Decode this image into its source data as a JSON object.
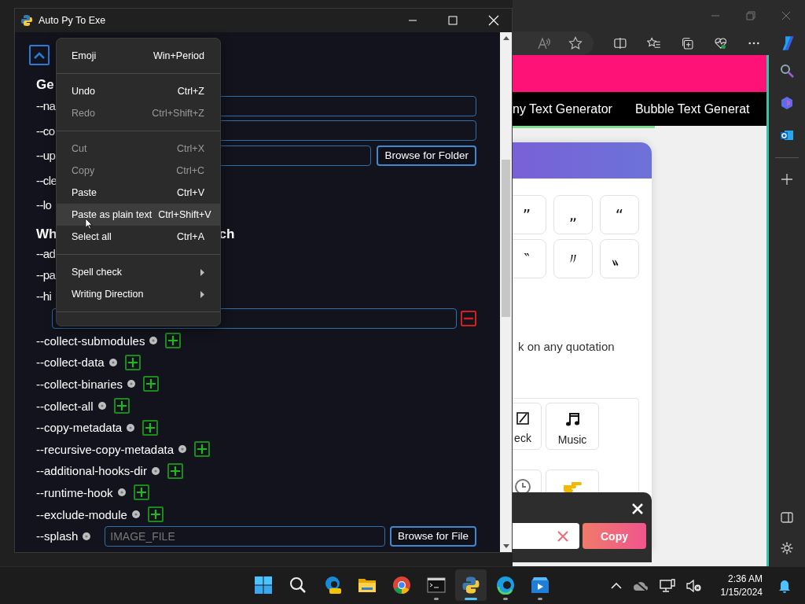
{
  "app_window": {
    "title": "Auto Py To Exe",
    "general": {
      "heading": "Ge",
      "rows": [
        {
          "kind": "input",
          "label": "--na"
        },
        {
          "kind": "input",
          "label": "--co"
        },
        {
          "kind": "folder",
          "label": "--up",
          "button": "Browse for Folder"
        },
        {
          "kind": "plain",
          "label": "--cle"
        },
        {
          "kind": "plain",
          "label": "--lo"
        }
      ]
    },
    "bundle": {
      "heading_start": "Wh",
      "heading_end": "ch",
      "rows": [
        {
          "kind": "plain",
          "label": "--ad"
        },
        {
          "kind": "plain",
          "label": "--pa"
        },
        {
          "kind": "plain",
          "label": "--hi"
        },
        {
          "kind": "entry"
        },
        {
          "kind": "add",
          "label": "--collect-submodules"
        },
        {
          "kind": "add",
          "label": "--collect-data"
        },
        {
          "kind": "add",
          "label": "--collect-binaries"
        },
        {
          "kind": "add",
          "label": "--collect-all"
        },
        {
          "kind": "add",
          "label": "--copy-metadata"
        },
        {
          "kind": "add",
          "label": "--recursive-copy-metadata"
        },
        {
          "kind": "add",
          "label": "--additional-hooks-dir"
        },
        {
          "kind": "add",
          "label": "--runtime-hook"
        },
        {
          "kind": "add",
          "label": "--exclude-module"
        },
        {
          "kind": "file",
          "label": "--splash",
          "placeholder": "IMAGE_FILE",
          "button": "Browse for File"
        }
      ]
    }
  },
  "context_menu": {
    "items": [
      {
        "kind": "item",
        "label": "Emoji",
        "shortcut": "Win+Period",
        "disabled": false,
        "selected": false
      },
      {
        "kind": "separator"
      },
      {
        "kind": "item",
        "label": "Undo",
        "shortcut": "Ctrl+Z",
        "disabled": false,
        "selected": false
      },
      {
        "kind": "item",
        "label": "Redo",
        "shortcut": "Ctrl+Shift+Z",
        "disabled": true,
        "selected": false
      },
      {
        "kind": "separator"
      },
      {
        "kind": "item",
        "label": "Cut",
        "shortcut": "Ctrl+X",
        "disabled": true,
        "selected": false
      },
      {
        "kind": "item",
        "label": "Copy",
        "shortcut": "Ctrl+C",
        "disabled": true,
        "selected": false
      },
      {
        "kind": "item",
        "label": "Paste",
        "shortcut": "Ctrl+V",
        "disabled": false,
        "selected": false
      },
      {
        "kind": "item",
        "label": "Paste as plain text",
        "shortcut": "Ctrl+Shift+V",
        "disabled": false,
        "selected": true
      },
      {
        "kind": "item",
        "label": "Select all",
        "shortcut": "Ctrl+A",
        "disabled": false,
        "selected": false
      },
      {
        "kind": "separator"
      },
      {
        "kind": "submenu",
        "label": "Spell check",
        "disabled": false,
        "selected": false
      },
      {
        "kind": "submenu",
        "label": "Writing Direction",
        "disabled": false,
        "selected": false
      },
      {
        "kind": "separator"
      }
    ]
  },
  "browser": {
    "nav_links": [
      "ny Text Generator",
      "Bubble Text Generat"
    ],
    "quote_buttons": [
      "”",
      "„",
      "“",
      "‶",
      "〃",
      "〟"
    ],
    "instruction": "k on any quotation",
    "reading_progress": {
      "level": 0.56
    },
    "categories": [
      {
        "kind": "check",
        "label": "eck"
      },
      {
        "kind": "music",
        "label": "Music"
      },
      {
        "kind": "clock"
      },
      {
        "kind": "hand"
      }
    ],
    "copy_bar": {
      "button": "Copy"
    }
  },
  "taskbar": {
    "apps": [
      {
        "kind": "start",
        "selected": false,
        "running": false
      },
      {
        "kind": "search",
        "selected": false,
        "running": false
      },
      {
        "kind": "edge-beta",
        "selected": false,
        "running": false
      },
      {
        "kind": "files",
        "selected": false,
        "running": false
      },
      {
        "kind": "chrome",
        "selected": false,
        "running": false
      },
      {
        "kind": "terminal",
        "selected": false,
        "running": true
      },
      {
        "kind": "python",
        "selected": true,
        "running": true
      },
      {
        "kind": "edge",
        "selected": false,
        "running": true
      },
      {
        "kind": "player",
        "selected": false,
        "running": true
      }
    ],
    "time": "2:36 AM",
    "date": "1/15/2024"
  }
}
